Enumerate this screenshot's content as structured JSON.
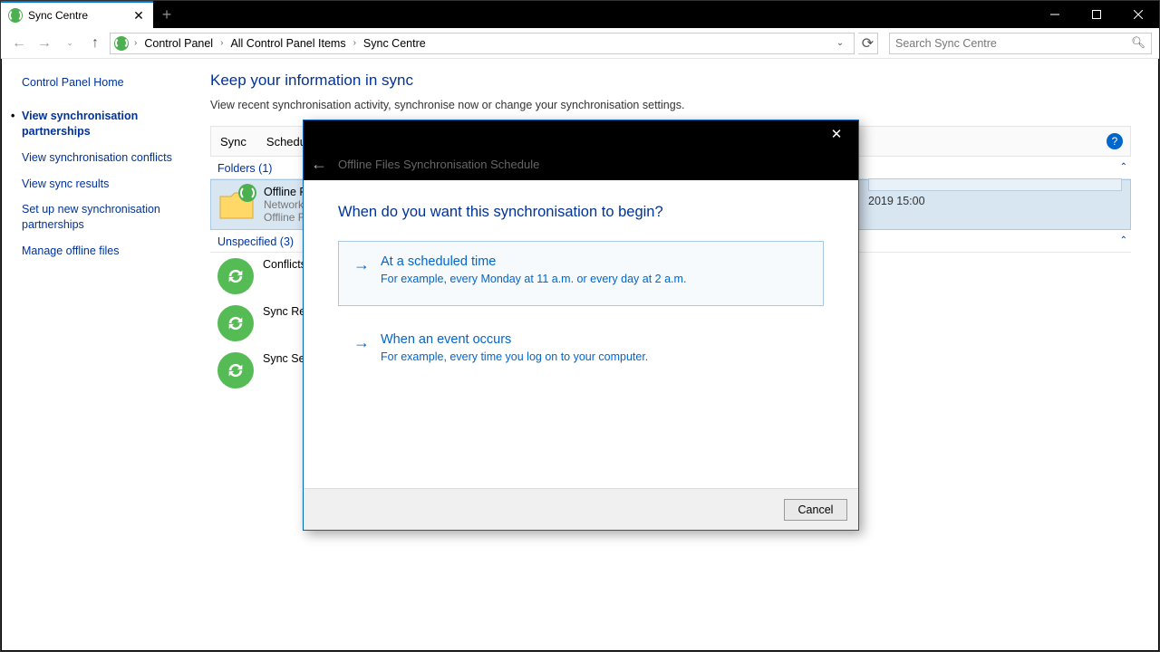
{
  "tab": {
    "title": "Sync Centre"
  },
  "breadcrumb": {
    "p1": "Control Panel",
    "p2": "All Control Panel Items",
    "p3": "Sync Centre"
  },
  "search": {
    "placeholder": "Search Sync Centre"
  },
  "sidebar": {
    "home": "Control Panel Home",
    "items": [
      "View synchronisation partnerships",
      "View synchronisation conflicts",
      "View sync results",
      "Set up new synchronisation partnerships",
      "Manage offline files"
    ]
  },
  "page": {
    "title": "Keep your information in sync",
    "subtitle": "View recent synchronisation activity, synchronise now or change your synchronisation settings."
  },
  "toolbar": {
    "sync": "Sync",
    "schedule": "Schedule"
  },
  "groups": {
    "folders_label": "Folders (1)",
    "unspecified_label": "Unspecified (3)"
  },
  "offline": {
    "title": "Offline Files",
    "line1": "Network files available offline",
    "line2": "Offline Files allows you to access netw…"
  },
  "unspecified": {
    "conflicts": "Conflicts",
    "results": "Sync Results",
    "setup": "Sync Setup"
  },
  "schedule_badge": "2019 15:00",
  "dialog": {
    "crumb": "Offline Files Synchronisation Schedule",
    "heading": "When do you want this synchronisation to begin?",
    "opt1_title": "At a scheduled time",
    "opt1_sub": "For example, every Monday at 11 a.m. or every day at 2 a.m.",
    "opt2_title": "When an event occurs",
    "opt2_sub": "For example, every time you log on to your computer.",
    "cancel": "Cancel"
  }
}
